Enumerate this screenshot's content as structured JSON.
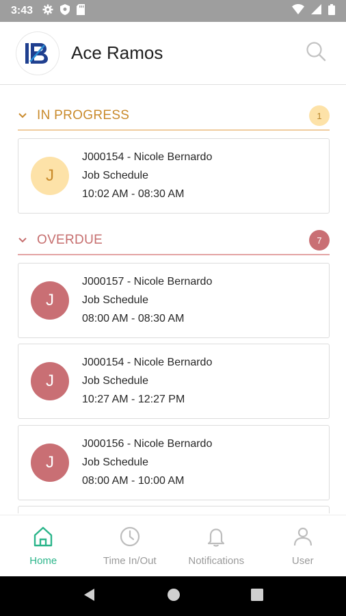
{
  "status_bar": {
    "time": "3:43",
    "icons": [
      "gear-icon",
      "shield-icon",
      "sd-card-icon",
      "wifi-icon",
      "signal-icon",
      "battery-icon"
    ]
  },
  "header": {
    "title": "Ace Ramos",
    "logo": "brand-logo-icon",
    "search_icon": "search-icon"
  },
  "sections": {
    "in_progress": {
      "title": "IN PROGRESS",
      "count": "1",
      "accent": "#c98a2b",
      "items": [
        {
          "avatar": "J",
          "line1": "J000154 - Nicole Bernardo",
          "line2": "Job Schedule",
          "line3": "10:02 AM - 08:30 AM"
        }
      ]
    },
    "overdue": {
      "title": "OVERDUE",
      "count": "7",
      "accent": "#c66e6e",
      "items": [
        {
          "avatar": "J",
          "line1": "J000157 - Nicole Bernardo",
          "line2": "Job Schedule",
          "line3": "08:00 AM - 08:30 AM"
        },
        {
          "avatar": "J",
          "line1": "J000154 - Nicole Bernardo",
          "line2": "Job Schedule",
          "line3": "10:27 AM - 12:27 PM"
        },
        {
          "avatar": "J",
          "line1": "J000156 - Nicole Bernardo",
          "line2": "Job Schedule",
          "line3": "08:00 AM - 10:00 AM"
        }
      ]
    }
  },
  "bottom_nav": {
    "active": "Home",
    "active_color": "#2bb58a",
    "items": [
      {
        "label": "Home",
        "icon": "home-icon"
      },
      {
        "label": "Time In/Out",
        "icon": "clock-icon"
      },
      {
        "label": "Notifications",
        "icon": "bell-icon"
      },
      {
        "label": "User",
        "icon": "user-icon"
      }
    ]
  }
}
